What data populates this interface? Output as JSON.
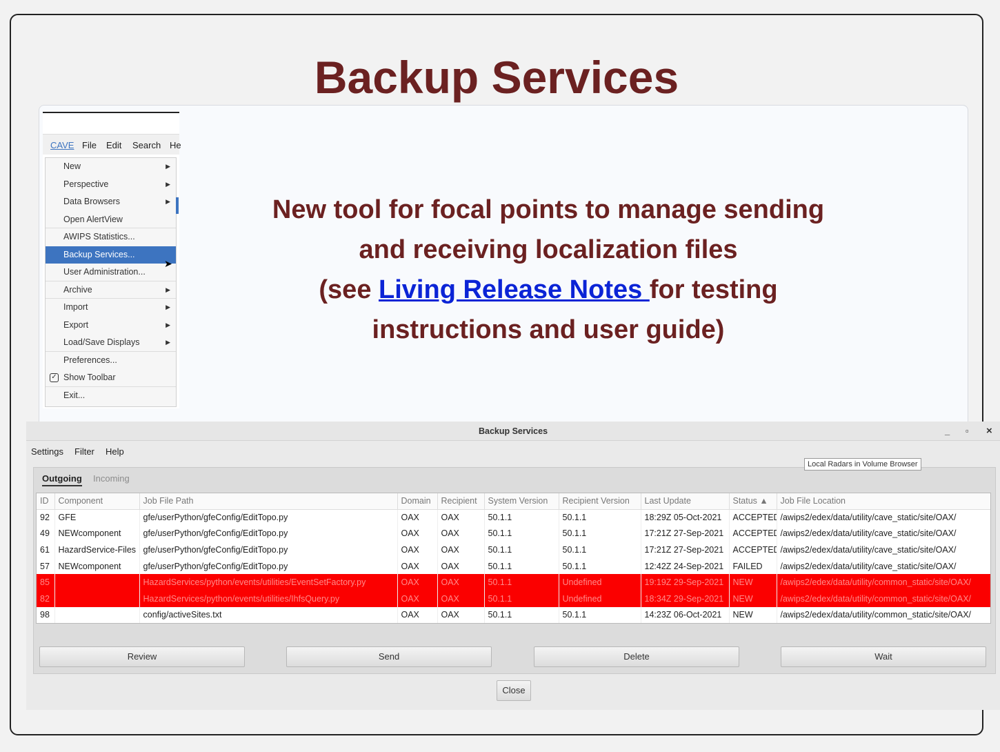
{
  "slide": {
    "title": "Backup Services",
    "desc_line1": "New tool for focal points to manage sending",
    "desc_line2": "and receiving localization files",
    "desc_line3_pre": "(see ",
    "desc_link": "Living Release Notes ",
    "desc_line3_post": "for testing",
    "desc_line4": "instructions and user guide)"
  },
  "cave": {
    "menubar": [
      "CAVE",
      "File",
      "Edit",
      "Search",
      "He"
    ],
    "items": [
      {
        "label": "New",
        "submenu": true
      },
      {
        "label": "Perspective",
        "submenu": true
      },
      {
        "label": "Data Browsers",
        "submenu": true
      },
      {
        "label": "Open AlertView",
        "submenu": false
      },
      {
        "label": "AWIPS Statistics...",
        "submenu": false
      },
      {
        "label": "Backup Services...",
        "submenu": false
      },
      {
        "label": "User Administration...",
        "submenu": false
      },
      {
        "label": "Archive",
        "submenu": true
      },
      {
        "label": "Import",
        "submenu": true
      },
      {
        "label": "Export",
        "submenu": true
      },
      {
        "label": "Load/Save Displays",
        "submenu": true
      },
      {
        "label": "Preferences...",
        "submenu": false
      },
      {
        "label": "Show Toolbar",
        "submenu": false
      },
      {
        "label": "Exit...",
        "submenu": false
      }
    ]
  },
  "window": {
    "title": "Backup Services",
    "controls": [
      "_",
      "▫",
      "×"
    ],
    "menu": [
      "Settings",
      "Filter",
      "Help"
    ],
    "tooltip": "Local Radars in Volume Browser",
    "tabs": {
      "outgoing": "Outgoing",
      "incoming": "Incoming"
    },
    "columns": [
      "ID",
      "Component",
      "Job File Path",
      "Domain",
      "Recipient",
      "System Version",
      "Recipient Version",
      "Last Update",
      "Status ▲",
      "Job File Location"
    ],
    "rows": [
      {
        "cells": [
          "92",
          "GFE",
          "gfe/userPython/gfeConfig/EditTopo.py",
          "OAX",
          "OAX",
          "50.1.1",
          "50.1.1",
          "18:29Z 05-Oct-2021",
          "ACCEPTED",
          "/awips2/edex/data/utility/cave_static/site/OAX/"
        ],
        "error": false
      },
      {
        "cells": [
          "49",
          "NEWcomponent",
          "gfe/userPython/gfeConfig/EditTopo.py",
          "OAX",
          "OAX",
          "50.1.1",
          "50.1.1",
          "17:21Z 27-Sep-2021",
          "ACCEPTED",
          "/awips2/edex/data/utility/cave_static/site/OAX/"
        ],
        "error": false
      },
      {
        "cells": [
          "61",
          "HazardService-Files",
          "gfe/userPython/gfeConfig/EditTopo.py",
          "OAX",
          "OAX",
          "50.1.1",
          "50.1.1",
          "17:21Z 27-Sep-2021",
          "ACCEPTED",
          "/awips2/edex/data/utility/cave_static/site/OAX/"
        ],
        "error": false
      },
      {
        "cells": [
          "57",
          "NEWcomponent",
          "gfe/userPython/gfeConfig/EditTopo.py",
          "OAX",
          "OAX",
          "50.1.1",
          "50.1.1",
          "12:42Z 24-Sep-2021",
          "FAILED",
          "/awips2/edex/data/utility/cave_static/site/OAX/"
        ],
        "error": false
      },
      {
        "cells": [
          "85",
          "",
          "HazardServices/python/events/utilities/EventSetFactory.py",
          "OAX",
          "OAX",
          "50.1.1",
          "Undefined",
          "19:19Z 29-Sep-2021",
          "NEW",
          "/awips2/edex/data/utility/common_static/site/OAX/"
        ],
        "error": true
      },
      {
        "cells": [
          "82",
          "",
          "HazardServices/python/events/utilities/IhfsQuery.py",
          "OAX",
          "OAX",
          "50.1.1",
          "Undefined",
          "18:34Z 29-Sep-2021",
          "NEW",
          "/awips2/edex/data/utility/common_static/site/OAX/"
        ],
        "error": true
      },
      {
        "cells": [
          "98",
          "",
          "config/activeSites.txt",
          "OAX",
          "OAX",
          "50.1.1",
          "50.1.1",
          "14:23Z 06-Oct-2021",
          "NEW",
          "/awips2/edex/data/utility/common_static/site/OAX/"
        ],
        "error": false
      }
    ],
    "buttons": {
      "review": "Review",
      "send": "Send",
      "delete": "Delete",
      "wait": "Wait",
      "close": "Close"
    }
  }
}
